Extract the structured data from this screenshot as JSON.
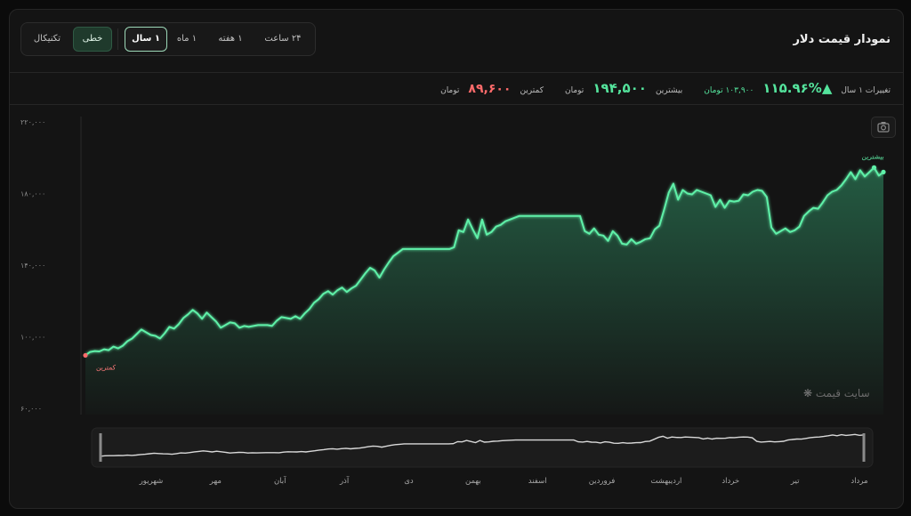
{
  "title": "نمودار قیمت دلار",
  "chart_type_buttons": [
    {
      "label": "تکنیکال"
    },
    {
      "label": "خطی"
    }
  ],
  "timeframes": [
    {
      "label": "۱ سال"
    },
    {
      "label": "۱ ماه"
    },
    {
      "label": "۱ هفته"
    },
    {
      "label": "۲۴ ساعت"
    }
  ],
  "stats": {
    "change_label": "تغییرات ۱ سال",
    "change_pct": "▲۱۱۵.۹۶%",
    "change_amount": "۱۰۳,۹۰۰",
    "change_unit": "تومان",
    "high_label": "بیشترین",
    "high_value": "۱۹۴,۵۰۰",
    "high_unit": "تومان",
    "low_label": "کمترین",
    "low_value": "۸۹,۶۰۰",
    "low_unit": "تومان"
  },
  "watermark": "سایت قیمت",
  "colors": {
    "accent": "#54e39c",
    "low": "#ff6b6b",
    "background": "#141414"
  },
  "icons": {
    "camera": "camera-icon",
    "watermark": "snowflake-logo-icon"
  },
  "chart_data": {
    "type": "area",
    "title": "",
    "xlabel": "",
    "ylabel": "",
    "ylim": [
      60000,
      220000
    ],
    "yticks": [
      60000,
      100000,
      140000,
      180000,
      220000
    ],
    "ytick_labels": [
      "۶۰,۰۰۰",
      "۱۰۰,۰۰۰",
      "۱۴۰,۰۰۰",
      "۱۸۰,۰۰۰",
      "۲۲۰,۰۰۰"
    ],
    "grid": false,
    "annotations": {
      "max_label": "بیشترین",
      "min_label": "کمترین"
    },
    "nav_months": [
      "شهریور",
      "مهر",
      "آبان",
      "آذر",
      "دی",
      "بهمن",
      "اسفند",
      "فروردین",
      "اردیبهشت",
      "خرداد",
      "تیر",
      "مرداد"
    ],
    "series": [
      {
        "values": [
          89600,
          91500,
          92000,
          91800,
          93000,
          92500,
          94500,
          93500,
          95000,
          97500,
          99000,
          101500,
          104000,
          102500,
          101000,
          100500,
          99000,
          102000,
          105500,
          104500,
          107000,
          110500,
          112500,
          115000,
          113000,
          110000,
          113500,
          111000,
          108500,
          105000,
          106500,
          108000,
          107500,
          105000,
          106000,
          105500,
          106000,
          106500,
          106500,
          106500,
          106000,
          109000,
          111000,
          110500,
          110000,
          111500,
          110000,
          113000,
          115500,
          119000,
          121000,
          124000,
          125500,
          123500,
          126000,
          127500,
          125000,
          127000,
          128500,
          132000,
          135500,
          138500,
          137000,
          133000,
          137500,
          141500,
          145000,
          147000,
          149000,
          149000,
          149000,
          149000,
          149000,
          149000,
          149000,
          149000,
          149000,
          149000,
          149000,
          150000,
          159500,
          158500,
          165500,
          160000,
          155000,
          165500,
          157000,
          158500,
          161500,
          162500,
          164500,
          165500,
          166500,
          167500,
          167500,
          167500,
          167500,
          167500,
          167500,
          167500,
          167500,
          167500,
          167500,
          167500,
          167500,
          167500,
          167500,
          159000,
          157500,
          160500,
          157000,
          156500,
          153500,
          159000,
          156500,
          152000,
          151500,
          154500,
          152000,
          153000,
          154500,
          155000,
          160000,
          162000,
          171000,
          180500,
          185500,
          176500,
          182000,
          180000,
          179500,
          182000,
          181000,
          180000,
          179000,
          172500,
          176500,
          172000,
          176000,
          175500,
          176000,
          179500,
          179000,
          181000,
          182000,
          181500,
          178000,
          161000,
          157500,
          159000,
          160500,
          158500,
          159500,
          161500,
          167500,
          170000,
          172000,
          171500,
          175000,
          179000,
          181000,
          182000,
          184500,
          188000,
          192000,
          188000,
          193000,
          189500,
          192000,
          194500,
          190000,
          192000
        ]
      }
    ]
  }
}
